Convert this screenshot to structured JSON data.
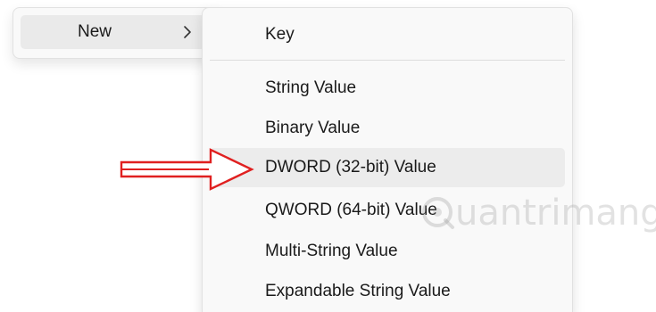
{
  "parent_menu": {
    "new_label": "New"
  },
  "submenu": {
    "items": [
      {
        "label": "Key"
      },
      {
        "label": "String Value"
      },
      {
        "label": "Binary Value"
      },
      {
        "label": "DWORD (32-bit) Value",
        "highlighted": true
      },
      {
        "label": "QWORD (64-bit) Value"
      },
      {
        "label": "Multi-String Value"
      },
      {
        "label": "Expandable String Value"
      }
    ]
  },
  "watermark": {
    "text": "uantrimang"
  },
  "colors": {
    "menu_bg": "#f9f9f9",
    "hover_bg": "#eaeaea",
    "arrow": "#e02020",
    "text": "#1a1a1a"
  },
  "icons": {
    "chevron": "chevron-right-icon",
    "annotation": "red-arrow-icon",
    "watermark_logo": "quantrimang-logo-icon"
  }
}
